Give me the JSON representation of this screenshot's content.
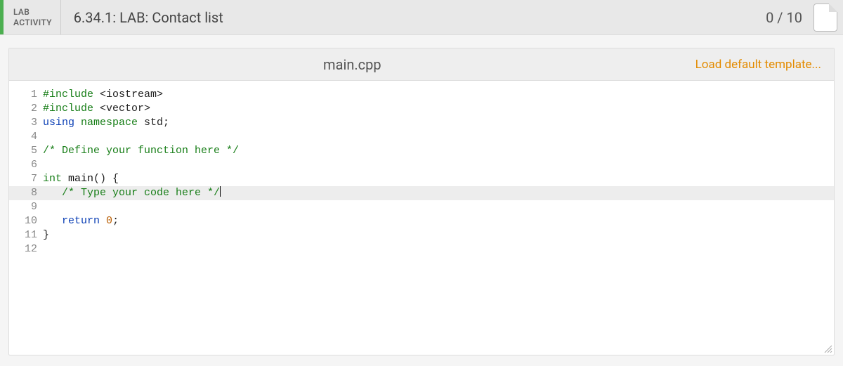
{
  "header": {
    "badge_line1": "LAB",
    "badge_line2": "ACTIVITY",
    "title": "6.34.1: LAB: Contact list",
    "score": "0 / 10"
  },
  "editor": {
    "filename": "main.cpp",
    "load_template_label": "Load default template...",
    "lines": {
      "l1_a": "#include",
      "l1_b": " <iostream>",
      "l2_a": "#include",
      "l2_b": " <vector>",
      "l3_a": "using",
      "l3_b": " namespace",
      "l3_c": " std;",
      "l5": "/* Define your function here */",
      "l7_a": "int",
      "l7_b": " main",
      "l7_c": "() {",
      "l8": "   /* Type your code here */",
      "l10_a": "   ",
      "l10_b": "return",
      "l10_c": " ",
      "l10_d": "0",
      "l10_e": ";",
      "l11": "}"
    },
    "gutter": {
      "n1": "1",
      "n2": "2",
      "n3": "3",
      "n4": "4",
      "n5": "5",
      "n6": "6",
      "n7": "7",
      "n8": "8",
      "n9": "9",
      "n10": "10",
      "n11": "11",
      "n12": "12"
    }
  }
}
